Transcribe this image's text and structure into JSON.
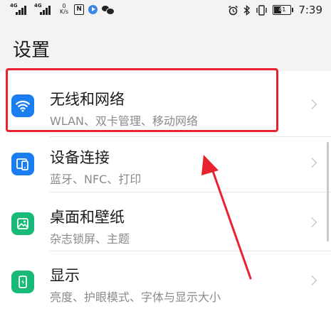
{
  "status_bar": {
    "sim1_label": "4G",
    "sim2_label": "4G",
    "speed_value": "0",
    "speed_unit": "K/s",
    "nfc_label": "N",
    "battery_level": "41",
    "time": "7:39",
    "icons": [
      "signal-4g-icon",
      "signal-4g-icon",
      "nfc-icon",
      "video-app-icon",
      "chat-icon",
      "alarm-icon",
      "bluetooth-icon",
      "vibrate-icon",
      "battery-icon"
    ]
  },
  "page": {
    "title": "设置"
  },
  "settings_items": [
    {
      "title": "无线和网络",
      "subtitle": "WLAN、双卡管理、移动网络",
      "icon": "wifi-icon",
      "icon_color": "#1a7ef0"
    },
    {
      "title": "设备连接",
      "subtitle": "蓝牙、NFC、打印",
      "icon": "device-connection-icon",
      "icon_color": "#1a7ef0"
    },
    {
      "title": "桌面和壁纸",
      "subtitle": "杂志锁屏、主题",
      "icon": "wallpaper-icon",
      "icon_color": "#19b97a"
    },
    {
      "title": "显示",
      "subtitle": "亮度、护眼模式、字体与显示大小",
      "icon": "display-icon",
      "icon_color": "#19b97a"
    }
  ],
  "annotation": {
    "highlight_color": "#e8232e",
    "arrow_color": "#e8232e"
  }
}
